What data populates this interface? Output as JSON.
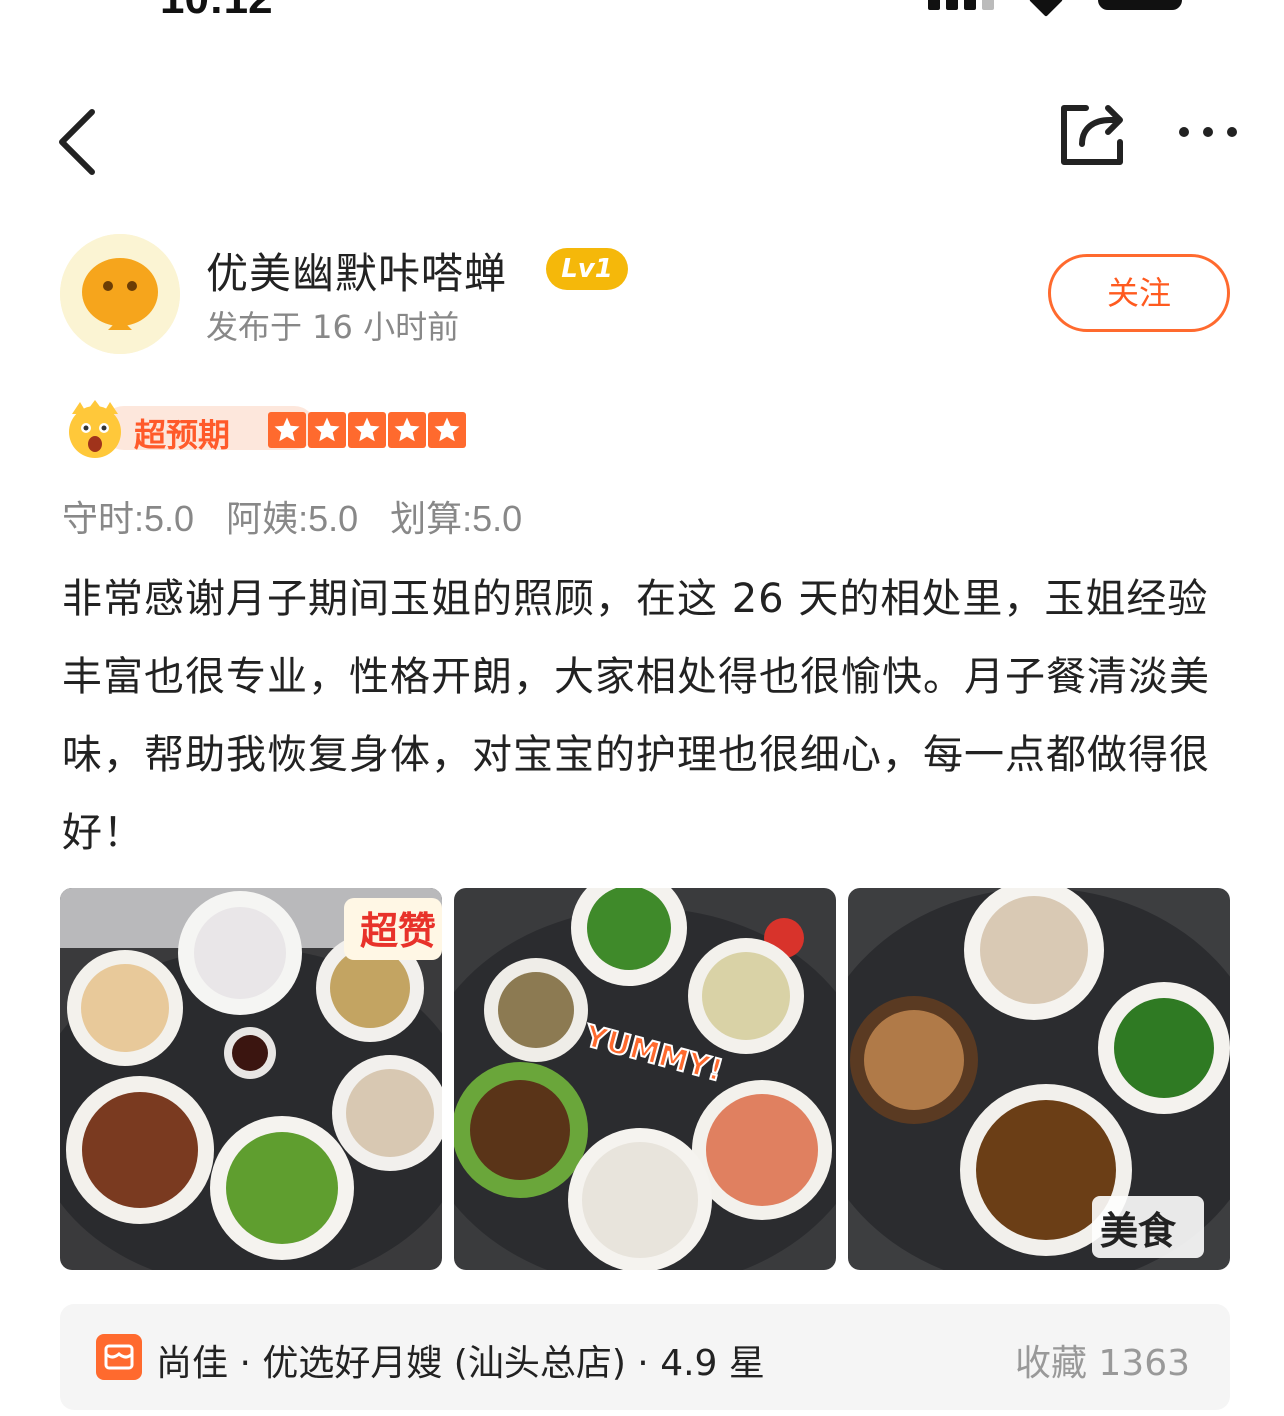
{
  "status_bar": {
    "time": "10:12"
  },
  "nav": {
    "back_icon": "chevron-left-icon",
    "share_icon": "share-icon",
    "more_icon": "more-dots-icon"
  },
  "user": {
    "name": "优美幽默咔嗒蝉",
    "level": "Lv1",
    "posted": "发布于 16 小时前",
    "follow_label": "关注"
  },
  "rating": {
    "expect_label": "超预期",
    "stars": 5,
    "sub_ratings": [
      {
        "label": "守时:5.0"
      },
      {
        "label": "阿姨:5.0"
      },
      {
        "label": "划算:5.0"
      }
    ]
  },
  "review": {
    "text": "非常感谢月子期间玉姐的照顾，在这 26 天的相处里，玉姐经验丰富也很专业，性格开朗，大家相处得也很愉快。月子餐清淡美味，帮助我恢复身体，对宝宝的护理也很细心，每一点都做得很好！"
  },
  "photos": {
    "p1_sticker": "超赞",
    "p2_sticker": "YUMMY!",
    "p3_sticker": "美食"
  },
  "store": {
    "name": "尚佳 · 优选好月嫂 (汕头总店) · 4.9 星",
    "collect": "收藏 1363"
  },
  "colors": {
    "accent": "#ff6a2e",
    "level": "#f5b80a",
    "muted": "#888888"
  }
}
